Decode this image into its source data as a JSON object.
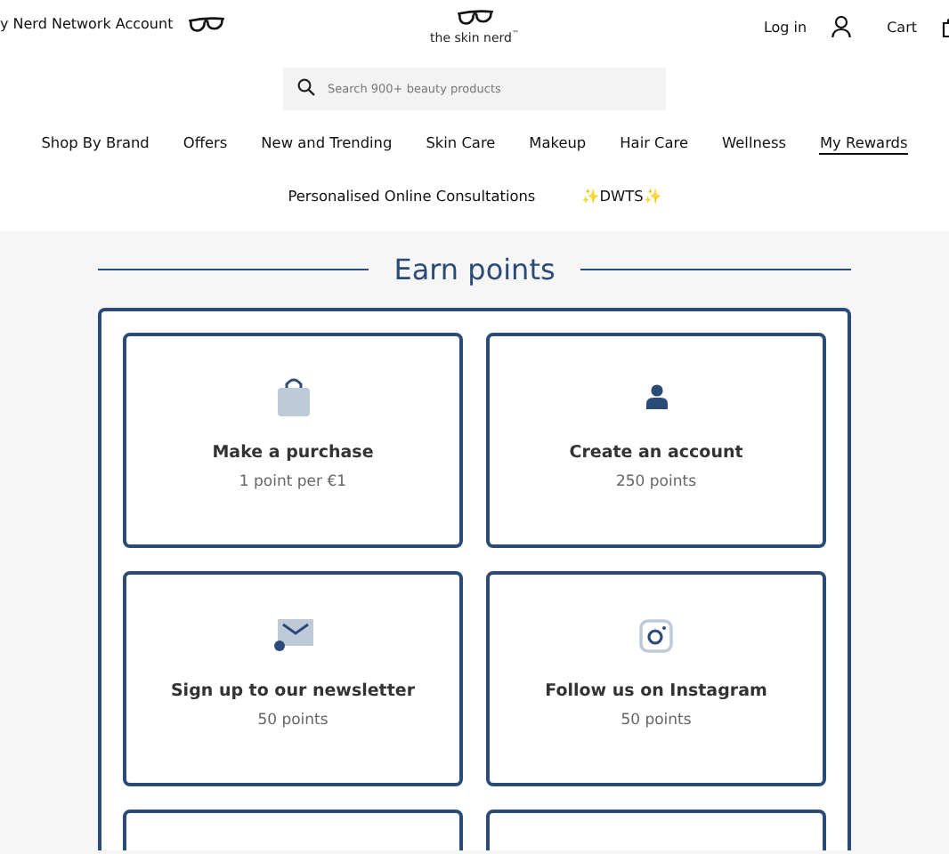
{
  "top_bar": {
    "account_link": "y Nerd Network Account",
    "logo_text": "the skin nerd",
    "logo_mark": "™",
    "login": "Log in",
    "cart": "Cart"
  },
  "search": {
    "placeholder": "Search 900+ beauty products"
  },
  "nav": [
    {
      "label": "Shop By Brand",
      "selected": false
    },
    {
      "label": "Offers",
      "selected": false
    },
    {
      "label": "New and Trending",
      "selected": false
    },
    {
      "label": "Skin Care",
      "selected": false
    },
    {
      "label": "Makeup",
      "selected": false
    },
    {
      "label": "Hair Care",
      "selected": false
    },
    {
      "label": "Wellness",
      "selected": false
    },
    {
      "label": "My Rewards",
      "selected": true
    }
  ],
  "nav_secondary": [
    {
      "label": "Personalised Online Consultations",
      "selected": false
    },
    {
      "label": "✨DWTS✨",
      "selected": false
    }
  ],
  "earn_points": {
    "title": "Earn points",
    "cards": [
      {
        "kind": "purchase",
        "title": "Make a purchase",
        "points": "1 point per €1"
      },
      {
        "kind": "account",
        "title": "Create an account",
        "points": "250 points"
      },
      {
        "kind": "newsletter",
        "title": "Sign up to our newsletter",
        "points": "50 points"
      },
      {
        "kind": "instagram",
        "title": "Follow us on Instagram",
        "points": "50 points"
      },
      {
        "kind": "empty"
      },
      {
        "kind": "empty"
      }
    ]
  }
}
